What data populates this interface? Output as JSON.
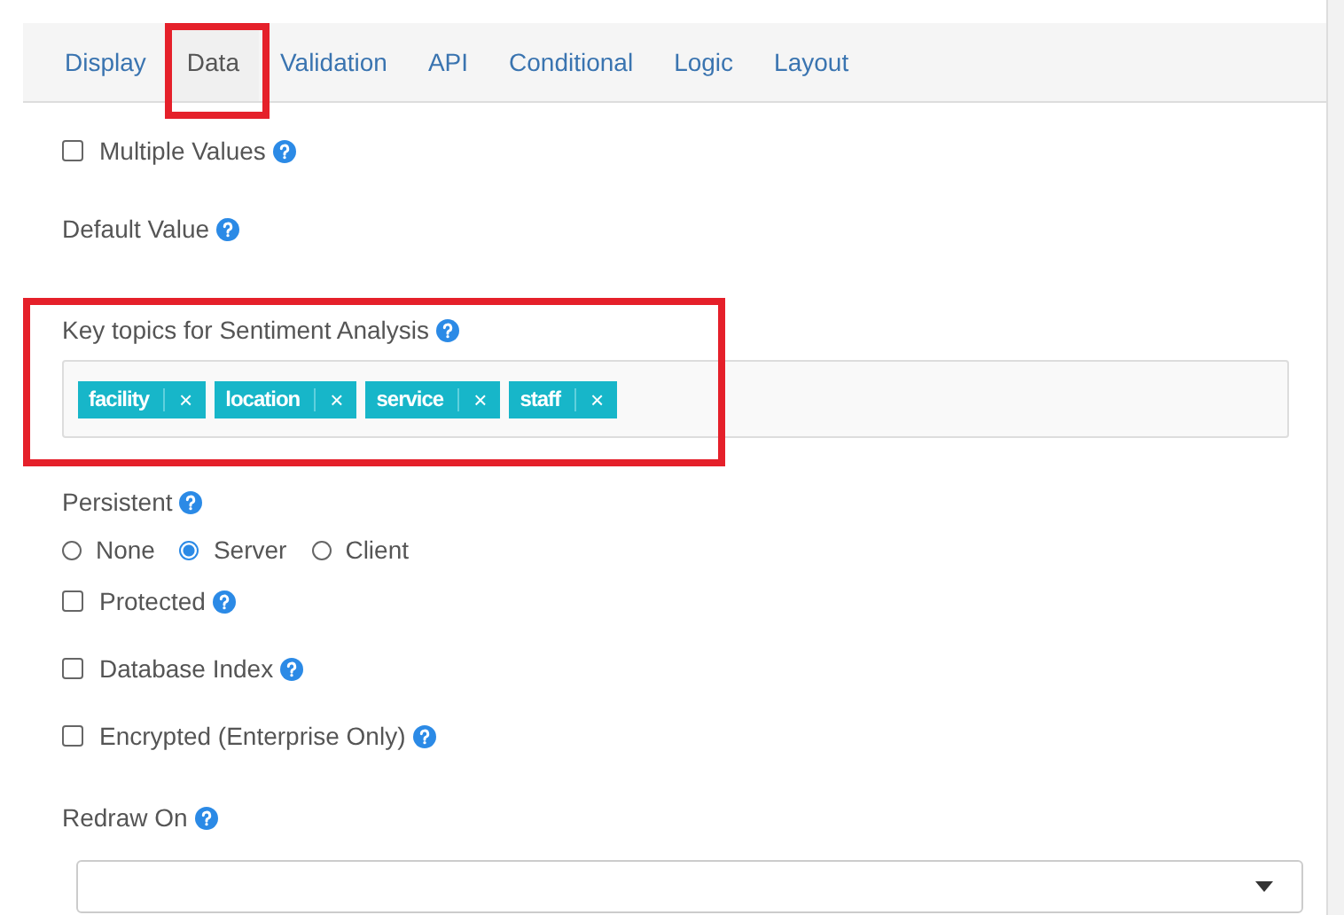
{
  "tabs": [
    {
      "label": "Display",
      "selected": false
    },
    {
      "label": "Data",
      "selected": true,
      "highlighted": true
    },
    {
      "label": "Validation",
      "selected": false
    },
    {
      "label": "API",
      "selected": false
    },
    {
      "label": "Conditional",
      "selected": false
    },
    {
      "label": "Logic",
      "selected": false
    },
    {
      "label": "Layout",
      "selected": false
    }
  ],
  "fields": [
    {
      "kind": "checkbox",
      "label": "Multiple Values",
      "checked": false
    },
    {
      "kind": "label",
      "label": "Default Value"
    },
    {
      "kind": "tags",
      "label": "Key topics for Sentiment Analysis",
      "highlighted": true,
      "tags": [
        "facility",
        "location",
        "service",
        "staff"
      ],
      "remove": "×"
    },
    {
      "kind": "radios",
      "label": "Persistent",
      "options": [
        {
          "label": "None",
          "selected": false
        },
        {
          "label": "Server",
          "selected": true
        },
        {
          "label": "Client",
          "selected": false
        }
      ]
    },
    {
      "kind": "checkbox",
      "label": "Protected",
      "checked": false
    },
    {
      "kind": "checkbox",
      "label": "Database Index",
      "checked": false
    },
    {
      "kind": "checkbox",
      "label": "Encrypted (Enterprise Only)",
      "checked": false
    },
    {
      "kind": "select",
      "label": "Redraw On"
    }
  ]
}
